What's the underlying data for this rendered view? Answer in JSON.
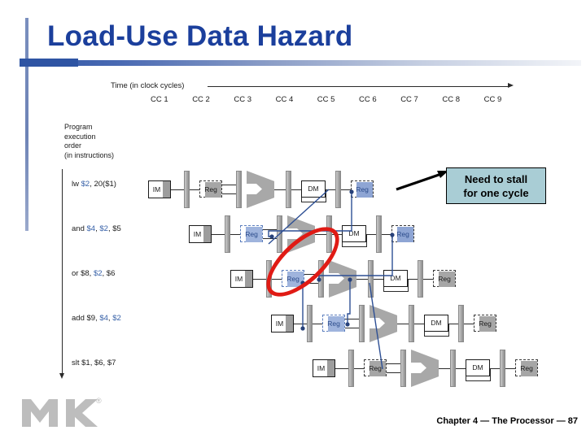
{
  "slide": {
    "title": "Load-Use Data Hazard",
    "footer": "Chapter 4 — The Processor — 87",
    "logo_name": "MK",
    "logo_reg": "®",
    "accent_color": "#1b3f9c",
    "rule_color": "#2e54a3"
  },
  "figure": {
    "time_label": "Time (in clock cycles)",
    "clock_cycles": [
      "CC 1",
      "CC 2",
      "CC 3",
      "CC 4",
      "CC 5",
      "CC 6",
      "CC 7",
      "CC 8",
      "CC 9"
    ],
    "order_label_lines": [
      "Program",
      "execution",
      "order",
      "(in instructions)"
    ],
    "instructions": [
      {
        "text": "lw $2, 20($1)",
        "parts": [
          {
            "t": "lw ",
            "hi": false
          },
          {
            "t": "$2",
            "hi": true
          },
          {
            "t": ", 20($1)",
            "hi": false
          }
        ]
      },
      {
        "text": "and $4, $2, $5",
        "parts": [
          {
            "t": "and ",
            "hi": false
          },
          {
            "t": "$4",
            "hi": true
          },
          {
            "t": ", ",
            "hi": false
          },
          {
            "t": "$2",
            "hi": true
          },
          {
            "t": ", $5",
            "hi": false
          }
        ]
      },
      {
        "text": "or $8, $2, $6",
        "parts": [
          {
            "t": "or $8, ",
            "hi": false
          },
          {
            "t": "$2",
            "hi": true
          },
          {
            "t": ", $6",
            "hi": false
          }
        ]
      },
      {
        "text": "add $9, $4, $2",
        "parts": [
          {
            "t": "add $9, ",
            "hi": false
          },
          {
            "t": "$4",
            "hi": true
          },
          {
            "t": ", ",
            "hi": false
          },
          {
            "t": "$2",
            "hi": true
          },
          {
            "t": "",
            "hi": false
          }
        ]
      },
      {
        "text": "slt $1, $6, $7",
        "parts": [
          {
            "t": "slt $1, $6, $7",
            "hi": false
          }
        ]
      }
    ],
    "stages": [
      "IM",
      "Reg",
      "ALU",
      "DM",
      "Reg"
    ],
    "stage_labels": {
      "im": "IM",
      "reg": "Reg",
      "dm": "DM"
    },
    "hazard_marker": {
      "shape": "ellipse",
      "color": "#e01b15",
      "meaning": "backward-in-time forwarding not possible"
    },
    "callout": {
      "line1": "Need to stall",
      "line2": "for one cycle",
      "bg_color": "#a9cdd5",
      "border_color": "#000000"
    },
    "forward_wire_color": "#2d4f94"
  }
}
